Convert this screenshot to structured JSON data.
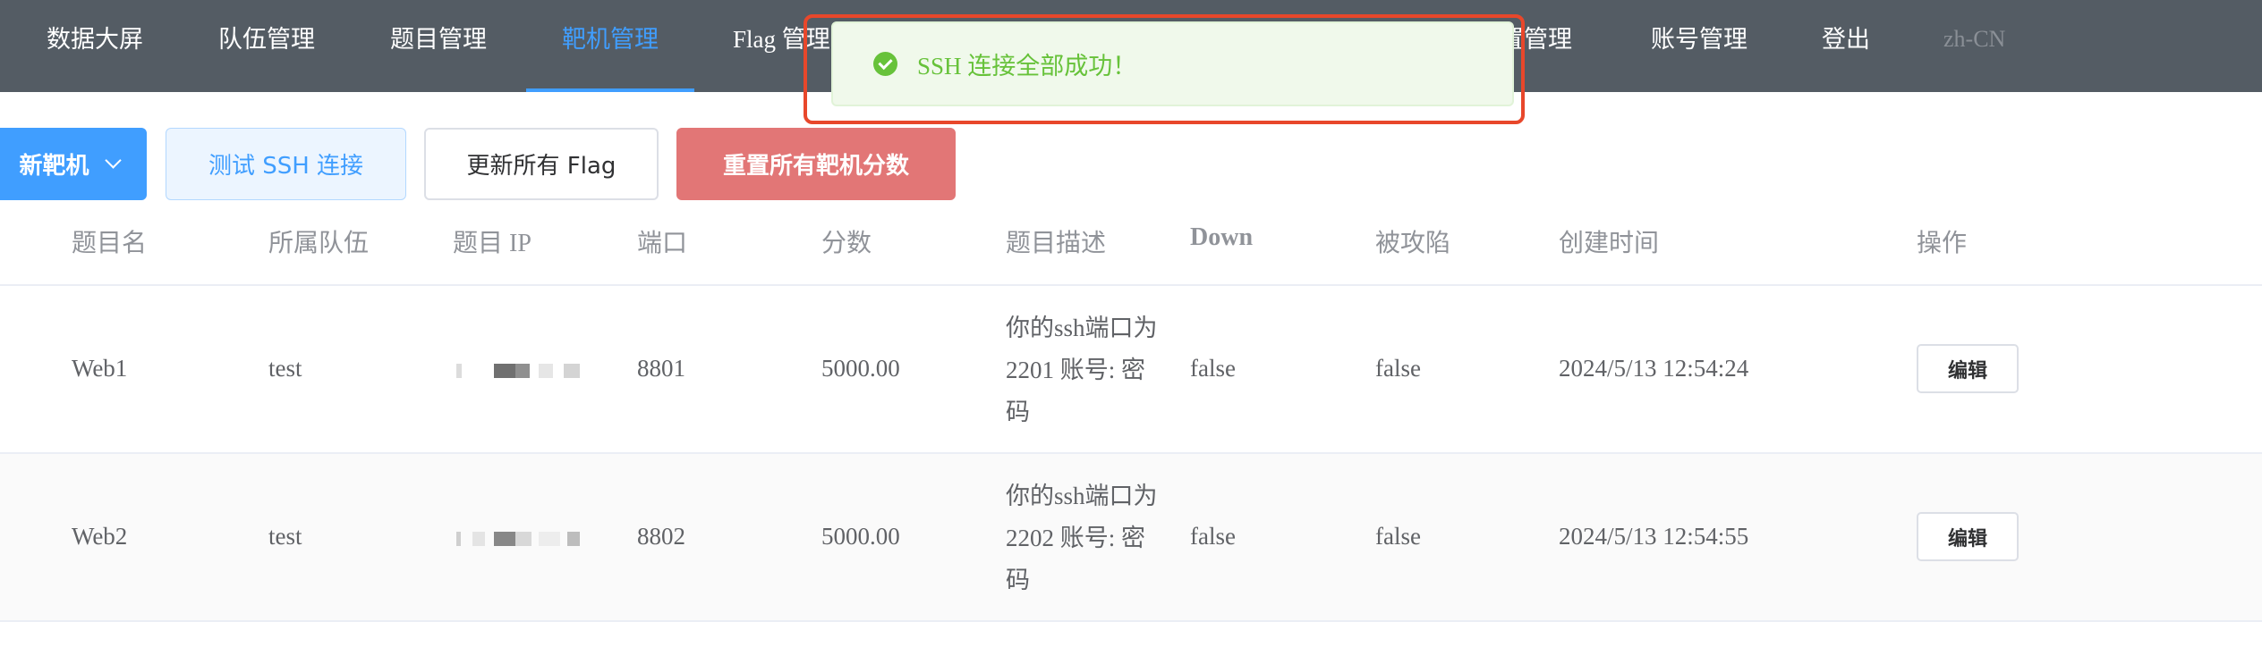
{
  "nav": {
    "items": [
      "数据大屏",
      "队伍管理",
      "题目管理",
      "靶机管理",
      "Flag 管理",
      "置管理",
      "账号管理",
      "登出"
    ],
    "active": "靶机管理",
    "lang": "zh-CN"
  },
  "toolbar": {
    "create_label": "新靶机",
    "test_ssh_label": "测试 SSH 连接",
    "update_flags_label": "更新所有 Flag",
    "reset_scores_label": "重置所有靶机分数"
  },
  "toast": {
    "message": "SSH 连接全部成功！",
    "type": "success"
  },
  "table": {
    "columns": [
      "题目名",
      "所属队伍",
      "题目 IP",
      "端口",
      "分数",
      "题目描述",
      "Down",
      "被攻陷",
      "创建时间",
      "操作"
    ],
    "rows": [
      {
        "name": "Web1",
        "team": "test",
        "ip": "",
        "port": "8801",
        "score": "5000.00",
        "description": "你的ssh端口为2201 账号: 密码",
        "down": "false",
        "compromised": "false",
        "created": "2024/5/13 12:54:24",
        "action": "编辑"
      },
      {
        "name": "Web2",
        "team": "test",
        "ip": "",
        "port": "8802",
        "score": "5000.00",
        "description": "你的ssh端口为2202 账号: 密码",
        "down": "false",
        "compromised": "false",
        "created": "2024/5/13 12:54:55",
        "action": "编辑"
      }
    ]
  },
  "colors": {
    "nav_bg": "#545c64",
    "accent": "#409eff",
    "danger": "#e27676",
    "success": "#67c23a",
    "highlight_outline": "#e8472b"
  }
}
